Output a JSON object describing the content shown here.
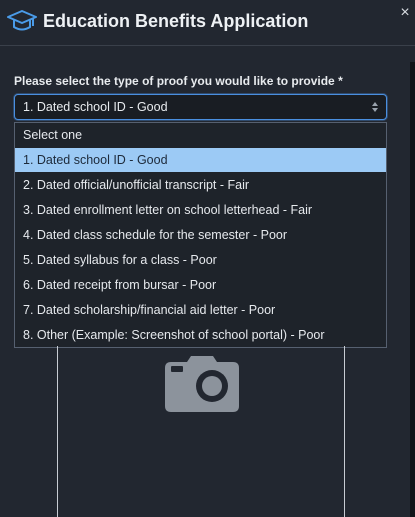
{
  "header": {
    "title": "Education Benefits Application",
    "close_icon": "close-icon",
    "icon": "graduation-cap-icon"
  },
  "form": {
    "proof_label": "Please select the type of proof you would like to provide *",
    "proof_select": {
      "selected_value": "1. Dated school ID - Good",
      "options": [
        "Select one",
        "1. Dated school ID - Good",
        "2. Dated official/unofficial transcript - Fair",
        "3. Dated enrollment letter on school letterhead - Fair",
        "4. Dated class schedule for the semester - Poor",
        "5. Dated syllabus for a class - Poor",
        "6. Dated receipt from bursar - Poor",
        "7. Dated scholarship/financial aid letter - Poor",
        "8. Other (Example: Screenshot of school portal) - Poor"
      ],
      "highlighted_index": 1
    },
    "upload_icon": "camera-icon"
  },
  "colors": {
    "accent": "#4a8fe0",
    "highlight": "#9ccaf5",
    "background": "#222730"
  }
}
